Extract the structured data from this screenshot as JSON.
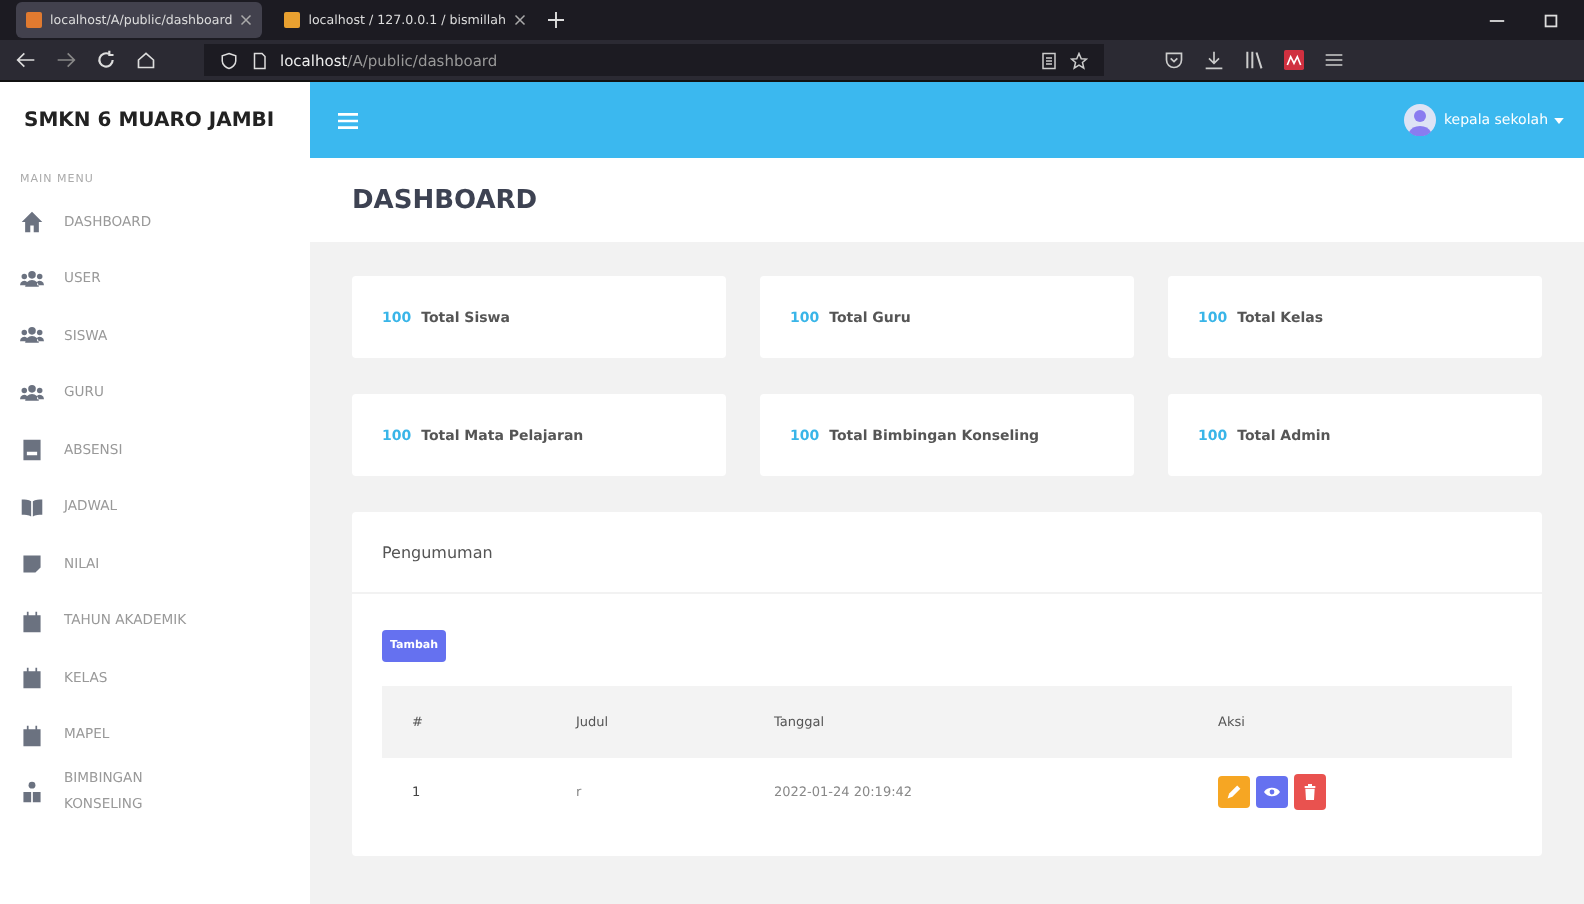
{
  "browser": {
    "tabs": [
      {
        "title": "localhost/A/public/dashboard",
        "selected": true
      },
      {
        "title": "localhost / 127.0.0.1 / bismillah",
        "selected": false
      }
    ],
    "address": {
      "host": "localhost",
      "path": "/A/public/dashboard"
    }
  },
  "sidebar": {
    "brand": "SMKN 6 MUARO JAMBI",
    "section": "MAIN MENU",
    "items": [
      {
        "label": "DASHBOARD"
      },
      {
        "label": "USER"
      },
      {
        "label": "SISWA"
      },
      {
        "label": "GURU"
      },
      {
        "label": "ABSENSI"
      },
      {
        "label": "JADWAL"
      },
      {
        "label": "NILAI"
      },
      {
        "label": "TAHUN AKADEMIK"
      },
      {
        "label": "KELAS"
      },
      {
        "label": "MAPEL"
      },
      {
        "label": "BIMBINGAN KONSELING"
      }
    ]
  },
  "topbar": {
    "user": "kepala sekolah"
  },
  "page_title": "DASHBOARD",
  "stats": [
    {
      "count": "100",
      "label": "Total Siswa"
    },
    {
      "count": "100",
      "label": "Total Guru"
    },
    {
      "count": "100",
      "label": "Total Kelas"
    },
    {
      "count": "100",
      "label": "Total Mata Pelajaran"
    },
    {
      "count": "100",
      "label": "Total Bimbingan Konseling"
    },
    {
      "count": "100",
      "label": "Total Admin"
    }
  ],
  "announcement": {
    "title": "Pengumuman",
    "add_button": "Tambah",
    "columns": [
      "#",
      "Judul",
      "Tanggal",
      "Aksi"
    ],
    "rows": [
      {
        "no": "1",
        "judul": "r",
        "tanggal": "2022-01-24 20:19:42"
      }
    ]
  }
}
